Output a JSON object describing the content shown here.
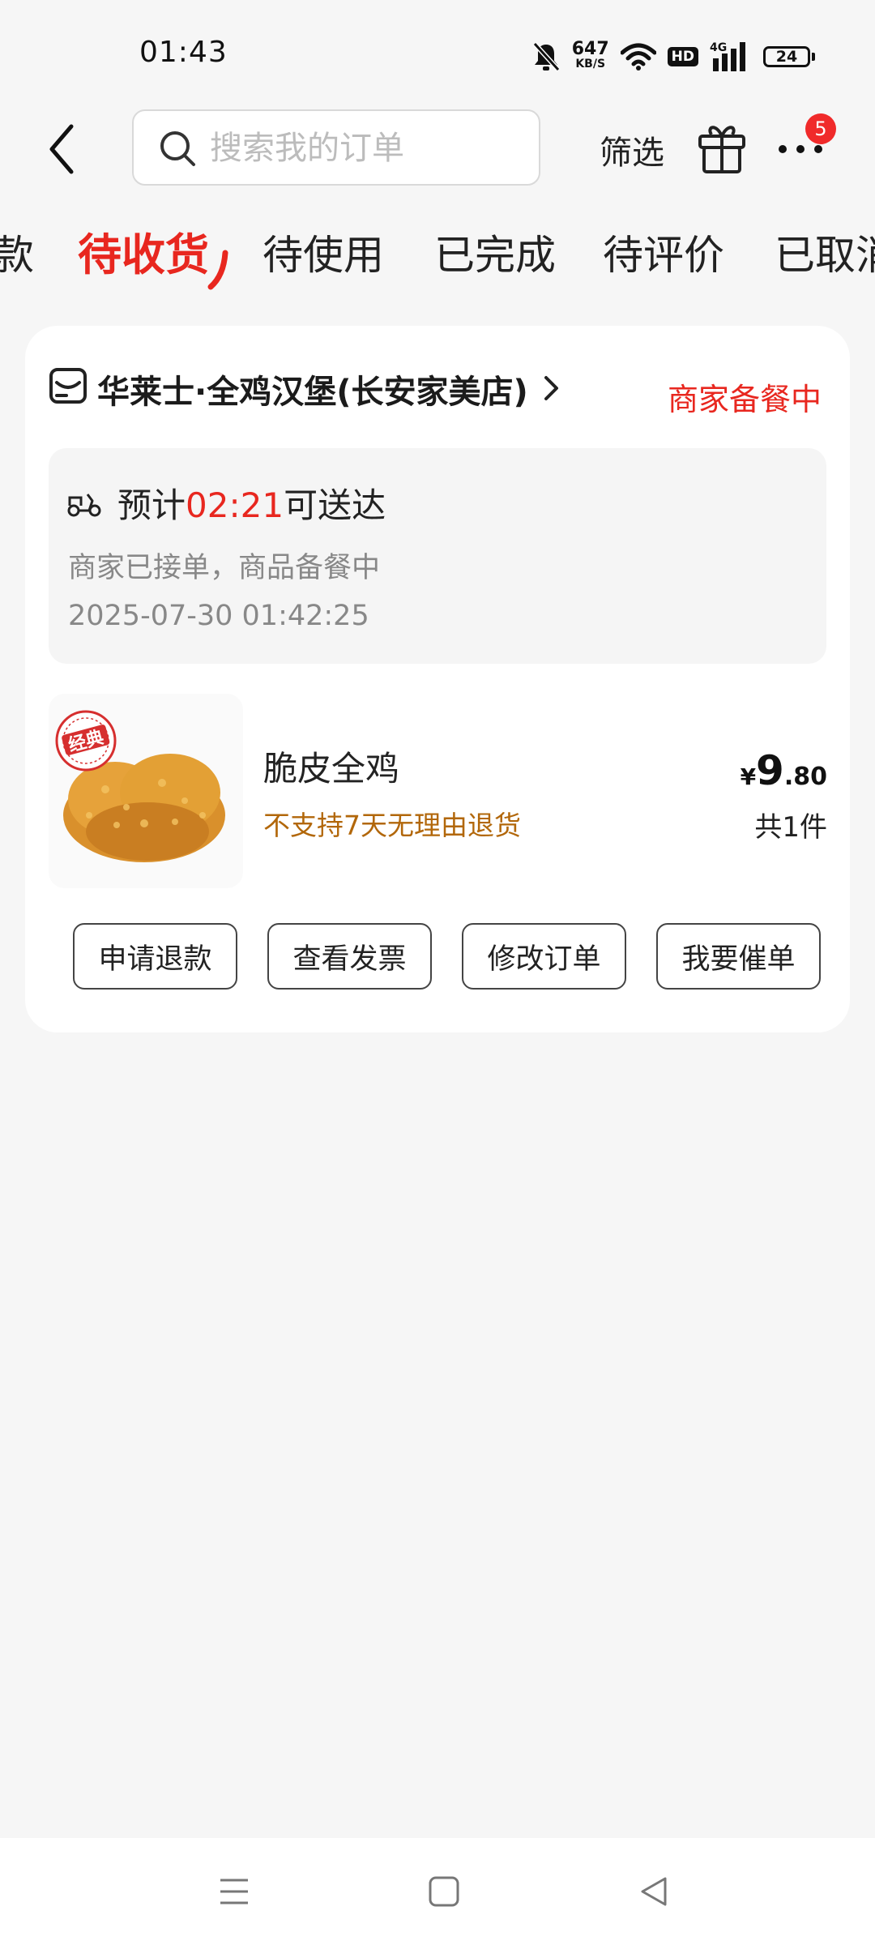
{
  "status_bar": {
    "time": "01:43",
    "net_speed_value": "647",
    "net_speed_unit": "KB/S",
    "hd": "HD",
    "network": "4G",
    "battery": "24",
    "icons": [
      "bell-muted-icon",
      "wifi-icon",
      "hd-icon",
      "signal-icon",
      "battery-icon"
    ]
  },
  "header": {
    "search_placeholder": "搜索我的订单",
    "filter_label": "筛选",
    "notification_count": "5",
    "icons": [
      "back-arrow-icon",
      "search-icon",
      "gift-icon",
      "more-dots-icon"
    ]
  },
  "tabs": [
    {
      "label": "款",
      "active": false
    },
    {
      "label": "待收货",
      "active": true
    },
    {
      "label": "待使用",
      "active": false
    },
    {
      "label": "已完成",
      "active": false
    },
    {
      "label": "待评价",
      "active": false
    },
    {
      "label": "已取消",
      "active": false
    }
  ],
  "order": {
    "store_name": "华莱士·全鸡汉堡(长安家美店)",
    "status": "商家备餐中",
    "eta_prefix": "预计",
    "eta_time": "02:21",
    "eta_suffix": "可送达",
    "eta_detail": "商家已接单，商品备餐中",
    "timestamp": "2025-07-30 01:42:25",
    "product": {
      "name": "脆皮全鸡",
      "note": "不支持7天无理由退货",
      "price_currency": "¥",
      "price_int": "9",
      "price_dec": ".80",
      "quantity": "共1件",
      "image_stamp": "经典"
    },
    "actions": [
      {
        "label": "申请退款"
      },
      {
        "label": "查看发票"
      },
      {
        "label": "修改订单"
      },
      {
        "label": "我要催单"
      }
    ]
  },
  "colors": {
    "accent": "#e8271f",
    "note": "#b2670a",
    "background": "#f6f6f6"
  }
}
